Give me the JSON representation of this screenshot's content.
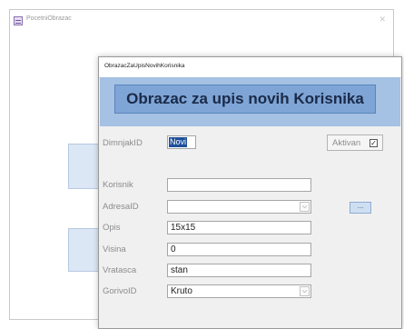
{
  "background_window": {
    "title": "PocetniObrazac",
    "close_glyph": "✕"
  },
  "dialog": {
    "title": "ObrazacZaUpisNovihKorisnika",
    "header_button": "Obrazac za upis novih Korisnika",
    "fields": {
      "dimnjak_label": "DimnjakID",
      "dimnjak_value": "Novi",
      "aktivan_label": "Aktivan",
      "aktivan_checked": "☑",
      "korisnik_label": "Korisnik",
      "korisnik_value": "",
      "adresa_label": "AdresaID",
      "adresa_value": "",
      "dots_label": "...",
      "opis_label": "Opis",
      "opis_value": "15x15",
      "visina_label": "Visina",
      "visina_value": "0",
      "vratasca_label": "Vratasca",
      "vratasca_value": "stan",
      "gorivo_label": "GorivoID",
      "gorivo_value": "Kruto"
    },
    "dropdown_glyph": "⌵"
  },
  "colors": {
    "header_band": "#a5c1e3",
    "header_button": "#7ea5d6",
    "selection": "#1e4f9a"
  }
}
